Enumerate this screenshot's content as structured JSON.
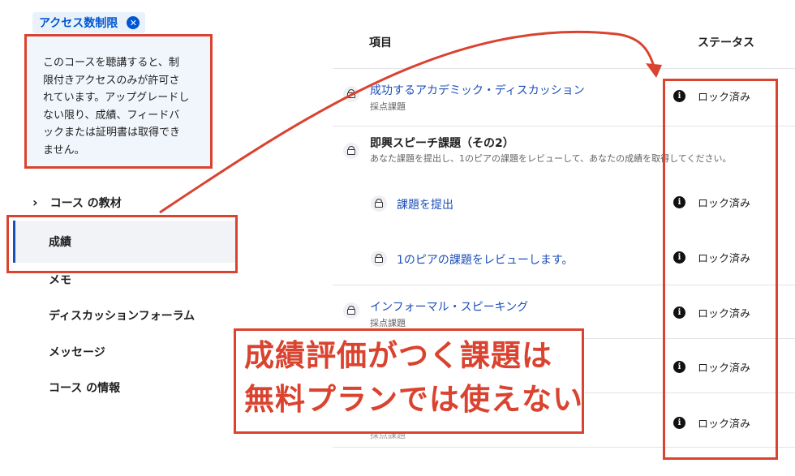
{
  "access_badge": {
    "label": "アクセス数制限"
  },
  "tooltip": {
    "lines": [
      "このコースを聴講すると、制",
      "限付きアクセスのみが許可さ",
      "れています。アップグレードし",
      "ない限り、成績、フィードバ",
      "ックまたは証明書は取得でき",
      "ません。"
    ]
  },
  "nav": {
    "course_materials": "コース の教材",
    "items": [
      "成績",
      "メモ",
      "ディスカッションフォーラム",
      "メッセージ",
      "コース の情報"
    ]
  },
  "table": {
    "headers": {
      "item": "項目",
      "status": "ステータス"
    },
    "rows": [
      {
        "title": "成功するアカデミック・ディスカッション",
        "subtitle": "採点課題",
        "status": "ロック済み"
      },
      {
        "title": "即興スピーチ課題（その2）",
        "subtitle": "あなた課題を提出し、1のピアの課題をレビューして、あなたの成績を取得してください。",
        "status": ""
      },
      {
        "title": "課題を提出",
        "subtitle": "",
        "status": "ロック済み"
      },
      {
        "title": "1のピアの課題をレビューします。",
        "subtitle": "",
        "status": "ロック済み"
      },
      {
        "title": "インフォーマル・スピーキング",
        "subtitle": "採点課題",
        "status": "ロック済み"
      },
      {
        "title": "",
        "subtitle": "",
        "status": "ロック済み"
      },
      {
        "title": "",
        "subtitle": "採点課題",
        "status": "ロック済み"
      }
    ]
  },
  "annotation": {
    "line1": "成績評価がつく課題は",
    "line2": "無料プランでは使えない"
  },
  "colors": {
    "annotation_red": "#d9432f",
    "link_blue": "#1c4fb8",
    "badge_blue": "#0056d2",
    "nav_indicator": "#1c4fb8"
  },
  "icons": {
    "badge_close": "close-circle-icon",
    "row_lock": "lock-icon",
    "status_info": "info-icon",
    "nav_expand": "chevron-right-icon"
  }
}
